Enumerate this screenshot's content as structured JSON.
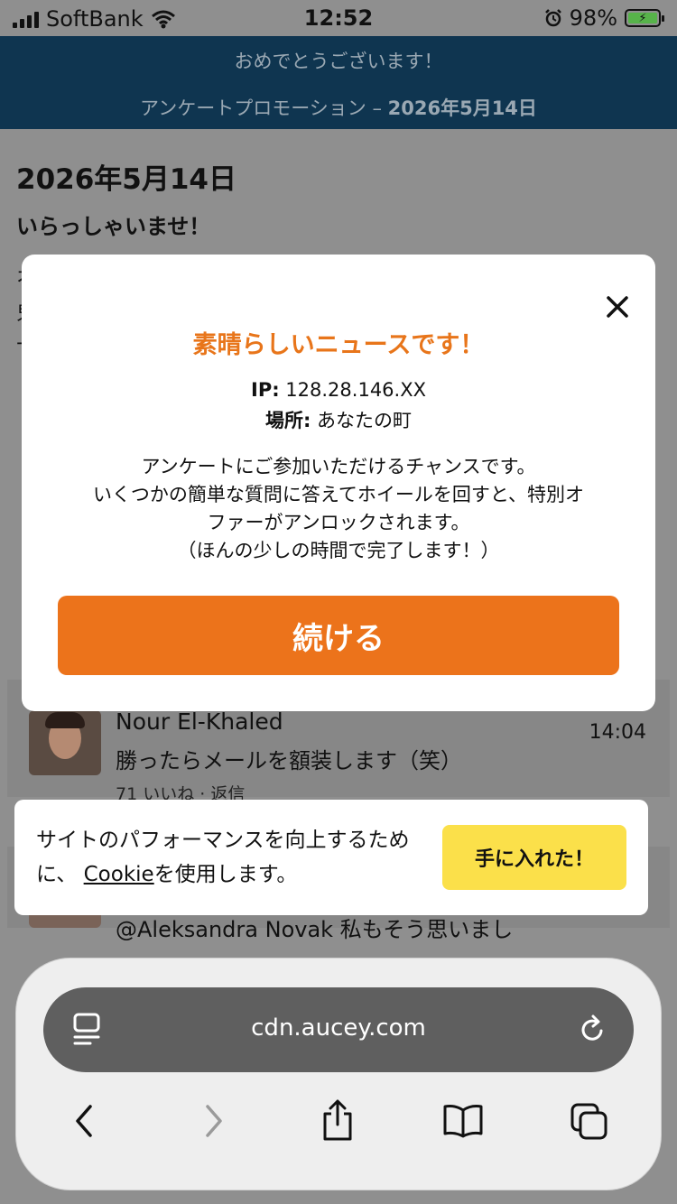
{
  "status_bar": {
    "carrier": "SoftBank",
    "time": "12:52",
    "battery_percent": "98%"
  },
  "banner": {
    "line1": "おめでとうございます！",
    "line2_prefix": "アンケートプロモーション – ",
    "line2_date": "2026年5月14日"
  },
  "page": {
    "date": "2026年5月14日",
    "greeting": "いらっしゃいませ！",
    "side_chars": [
      "オ",
      "鬼",
      "十"
    ]
  },
  "comments": [
    {
      "name": "Nour El-Khaled",
      "text": "勝ったらメールを額装します（笑）",
      "time": "14:04",
      "meta": "71 いいね · 返信"
    },
    {
      "text": "@Aleksandra Novak 私もそう思いまし"
    }
  ],
  "modal": {
    "title": "素晴らしいニュースです！",
    "ip_label": "IP:",
    "ip_value": "128.28.146.XX",
    "location_label": "場所:",
    "location_value": "あなたの町",
    "body_lines": [
      "アンケートにご参加いただけるチャンスです。",
      "いくつかの簡単な質問に答えてホイールを回すと、特別オ",
      "ファーがアンロックされます。",
      "（ほんの少しの時間で完了します！）"
    ],
    "button_label": "続ける",
    "close_icon": "close-icon",
    "title_color": "#e8751a",
    "button_color": "#ec731b"
  },
  "cookie": {
    "text_before": "サイトのパフォーマンスを向上するために、",
    "link": "Cookie",
    "text_after": "を使用します。",
    "button_label": "手に入れた！",
    "button_color": "#fbe04a"
  },
  "browser": {
    "url": "cdn.aucey.com",
    "icons": [
      "reader-icon",
      "reload-icon",
      "back-icon",
      "forward-icon",
      "share-icon",
      "bookmarks-icon",
      "tabs-icon"
    ]
  }
}
